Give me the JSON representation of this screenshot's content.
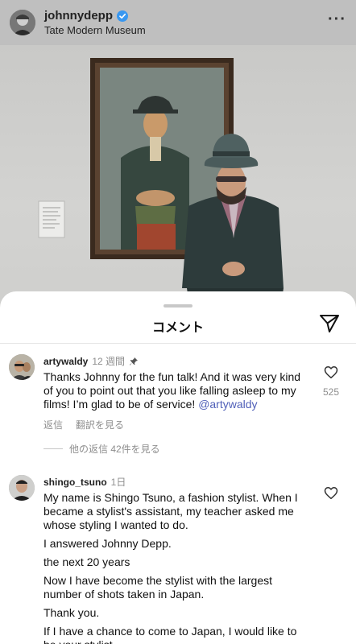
{
  "post": {
    "username": "johnnydepp",
    "location": "Tate Modern Museum",
    "verified": true,
    "more_icon": "ellipsis-icon"
  },
  "sheet": {
    "title": "コメント",
    "share_icon": "paper-plane-icon"
  },
  "comments": [
    {
      "username": "artywaldy",
      "time": "12 週間",
      "pinned": true,
      "text": "Thanks Johnny for the fun talk! And it was very kind of you to point out that you like falling asleep to my films! I’m glad to be of service!",
      "mention": "@artywaldy",
      "likes": "525",
      "reply_label": "返信",
      "translate_label": "翻訳を見る",
      "view_replies": "他の返信 42件を見る"
    },
    {
      "username": "shingo_tsuno",
      "time": "1日",
      "paragraphs": [
        "My name is Shingo Tsuno, a fashion stylist. When I became a stylist's assistant, my teacher asked me whose styling I wanted to do.",
        "I answered Johnny Depp.",
        "the next 20 years",
        "Now I have become the stylist with the largest number of shots taken in Japan.",
        "Thank you.",
        "If I have a chance to come to Japan, I would like to be your stylist."
      ]
    }
  ],
  "colors": {
    "mention": "#4f5fb8",
    "verified": "#3897f0",
    "meta_gray": "#8e8e8e"
  }
}
